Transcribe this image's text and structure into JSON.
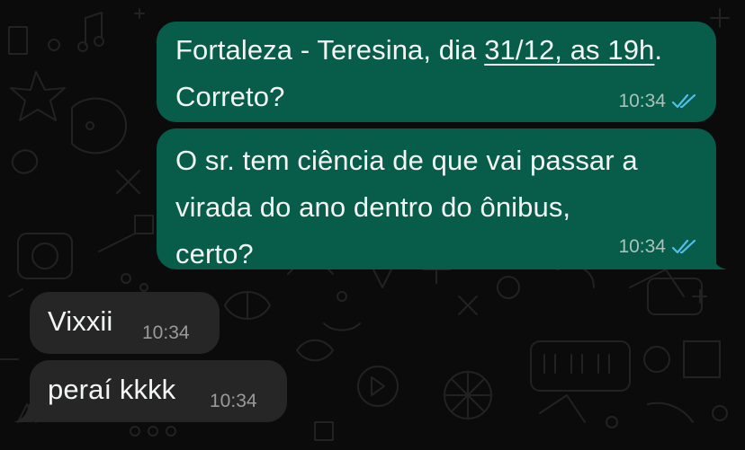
{
  "chat": {
    "messages": [
      {
        "direction": "outgoing",
        "text_parts": [
          "Fortaleza - Teresina, dia ",
          "31/12, as 19h",
          ".\nCorreto?"
        ],
        "time": "10:34",
        "status": "read",
        "status_icon": "double-check-icon",
        "status_color": "#53bdeb"
      },
      {
        "direction": "outgoing",
        "text": "O sr. tem ciência de que vai passar a\nvirada do ano dentro do ônibus,\ncerto?",
        "time": "10:34",
        "status": "read",
        "status_icon": "double-check-icon",
        "status_color": "#53bdeb"
      },
      {
        "direction": "incoming",
        "text": "Vixxii",
        "time": "10:34"
      },
      {
        "direction": "incoming",
        "text": "peraí kkkk",
        "time": "10:34"
      }
    ]
  },
  "theme": {
    "background": "#0b0b0b",
    "outgoing_bubble": "#075c4a",
    "incoming_bubble": "#262626",
    "read_tick": "#53bdeb"
  }
}
